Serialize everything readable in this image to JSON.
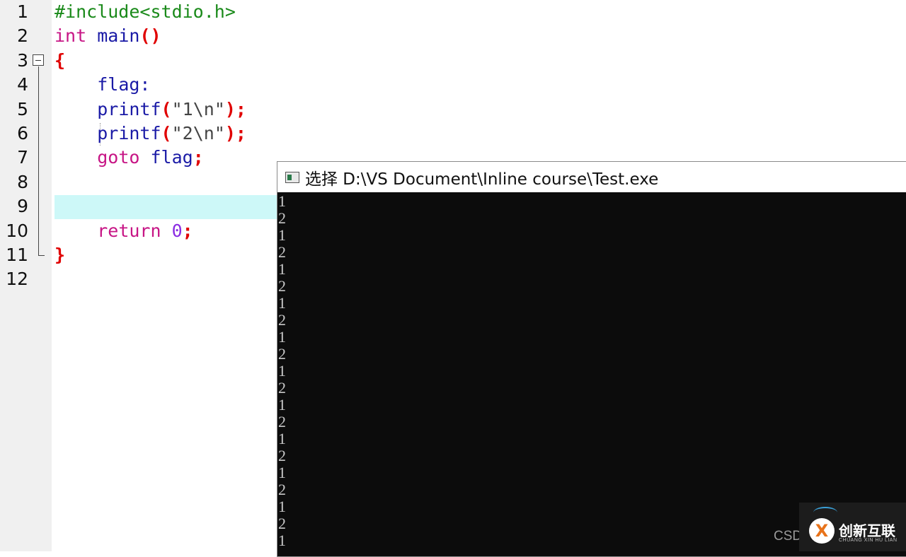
{
  "editor": {
    "line_numbers": [
      "1",
      "2",
      "3",
      "4",
      "5",
      "6",
      "7",
      "8",
      "9",
      "10",
      "11",
      "12"
    ],
    "code": {
      "l1": {
        "directive": "#include<stdio.h>"
      },
      "l2": {
        "type": "int",
        "name": "main",
        "parens": "()"
      },
      "l3": {
        "brace": "{"
      },
      "l4": {
        "label": "flag:"
      },
      "l5": {
        "fn": "printf",
        "open": "(",
        "str": "\"1",
        "esc": "\\n",
        "strend": "\"",
        "close": ");"
      },
      "l6": {
        "fn": "printf",
        "open": "(",
        "str": "\"2",
        "esc": "\\n",
        "strend": "\"",
        "close": ");"
      },
      "l7": {
        "kw": "goto",
        "target": "flag",
        "semi": ";"
      },
      "l10": {
        "kw": "return",
        "num": "0",
        "semi": ";"
      },
      "l11": {
        "brace": "}"
      }
    }
  },
  "console": {
    "title": "选择 D:\\VS Document\\Inline course\\Test.exe",
    "output": [
      "1",
      "2",
      "1",
      "2",
      "1",
      "2",
      "1",
      "2",
      "1",
      "2",
      "1",
      "2",
      "1",
      "2",
      "1",
      "2",
      "1",
      "2",
      "1",
      "2",
      "1"
    ]
  },
  "watermark": {
    "text": "CSD",
    "badge_title": "创新互联",
    "badge_sub": "CHUANG XIN HU LIAN",
    "logo_glyph": "X"
  }
}
